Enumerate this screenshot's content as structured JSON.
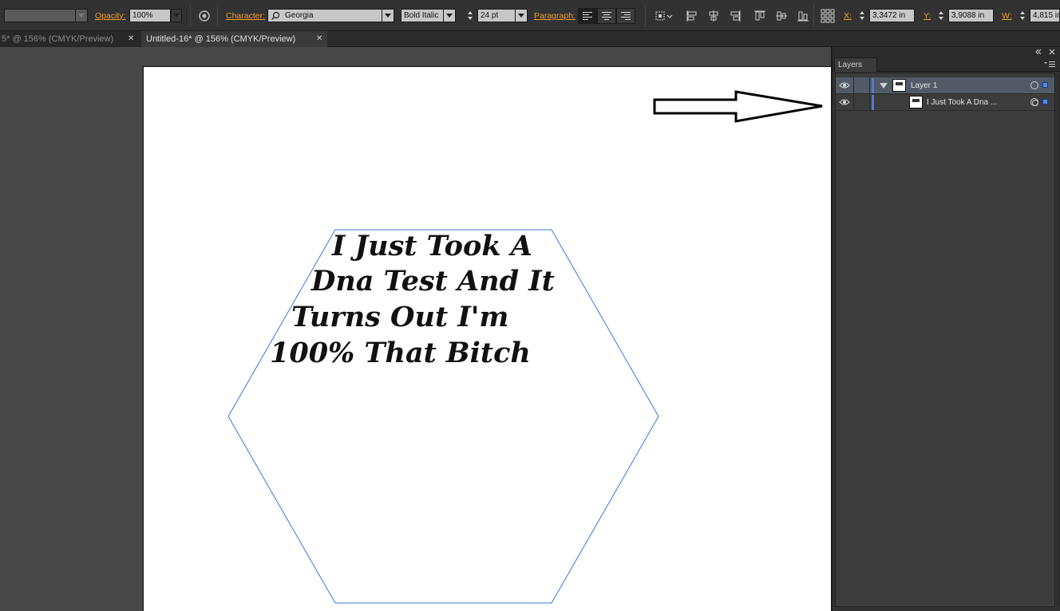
{
  "control_bar": {
    "opacity_label": "Opacity:",
    "opacity_value": "100%",
    "character_label": "Character:",
    "font_family": "Georgia",
    "font_style": "Bold Italic",
    "font_size": "24 pt",
    "paragraph_label": "Paragraph:",
    "x_label": "X:",
    "x_value": "3,3472 in",
    "y_label": "Y:",
    "y_value": "3,9088 in",
    "w_label": "W:",
    "w_value": "4,815 in"
  },
  "tabs": [
    {
      "label": "5* @ 156% (CMYK/Preview)",
      "close": "✕"
    },
    {
      "label": "Untitled-16* @ 156% (CMYK/Preview)",
      "close": "✕"
    }
  ],
  "artboard": {
    "text_lines": [
      "I Just Took A",
      "Dna Test And It",
      "Turns Out I'm",
      "100% That Bitch"
    ],
    "hexagon_stroke": "#3a78d8"
  },
  "layers_panel": {
    "tab_label": "Layers",
    "rows": [
      {
        "name": "Layer 1"
      },
      {
        "name": "I Just Took A Dna ..."
      }
    ]
  },
  "colors": {
    "accent_label": "#f0a030",
    "layer_color": "#4f78d8"
  }
}
